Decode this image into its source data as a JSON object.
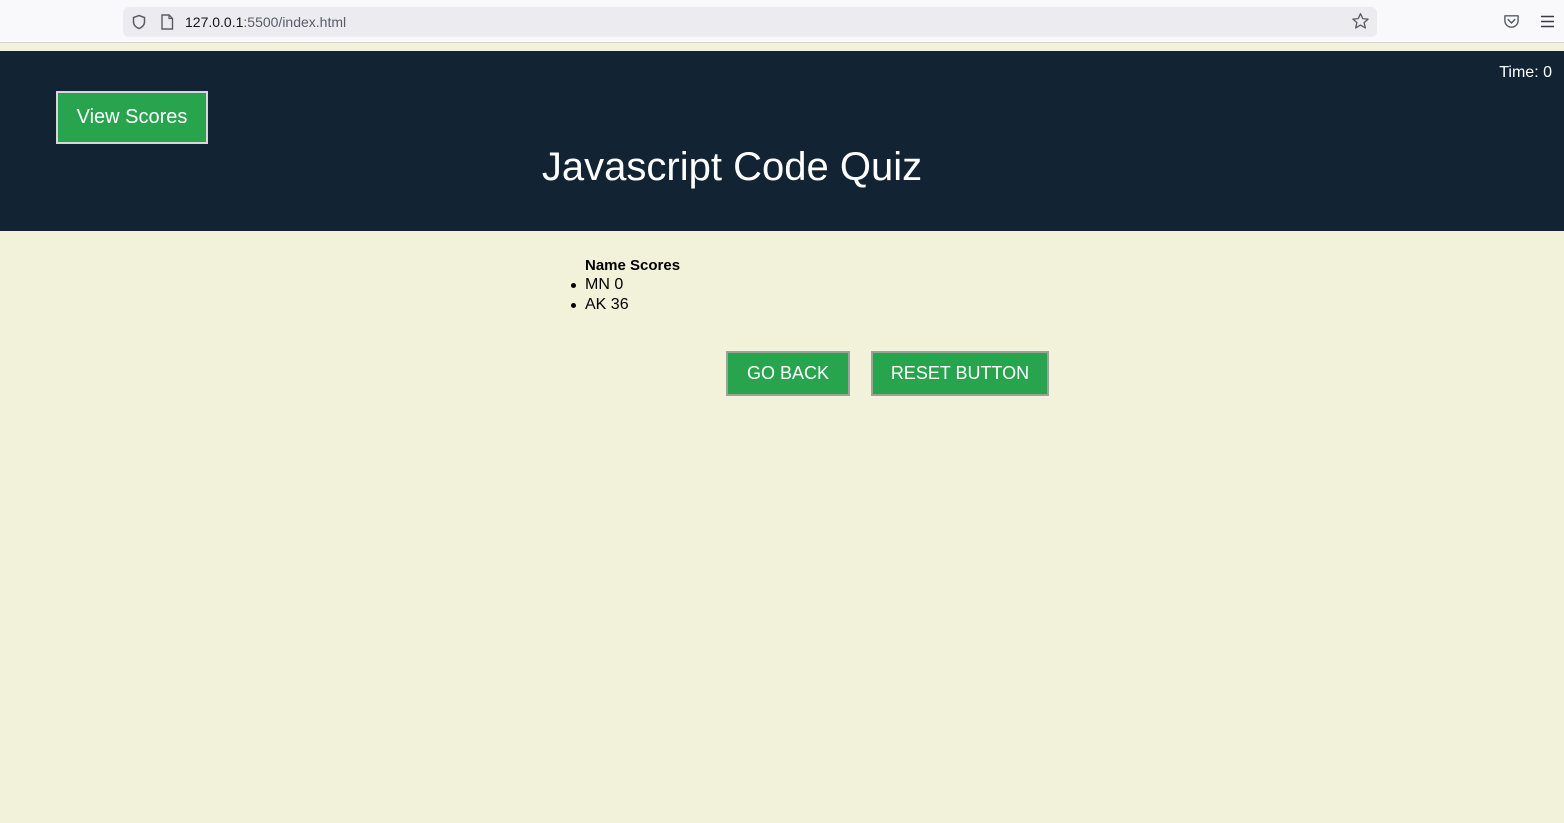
{
  "browser": {
    "url_host": "127.0.0.1",
    "url_rest": ":5500/index.html"
  },
  "header": {
    "view_scores_label": "View Scores",
    "timer_label": "Time: ",
    "timer_value": "0",
    "title": "Javascript Code Quiz"
  },
  "scores": {
    "heading": "Name Scores",
    "entries": [
      "MN 0",
      "AK 36"
    ]
  },
  "actions": {
    "go_back_label": "GO BACK",
    "reset_label": "RESET BUTTON"
  },
  "colors": {
    "page_background": "#f2f2da",
    "header_background": "#122334",
    "button_green": "#28a44e"
  },
  "icons": [
    "shield-icon",
    "page-icon",
    "star-icon",
    "pocket-icon",
    "menu-icon"
  ]
}
